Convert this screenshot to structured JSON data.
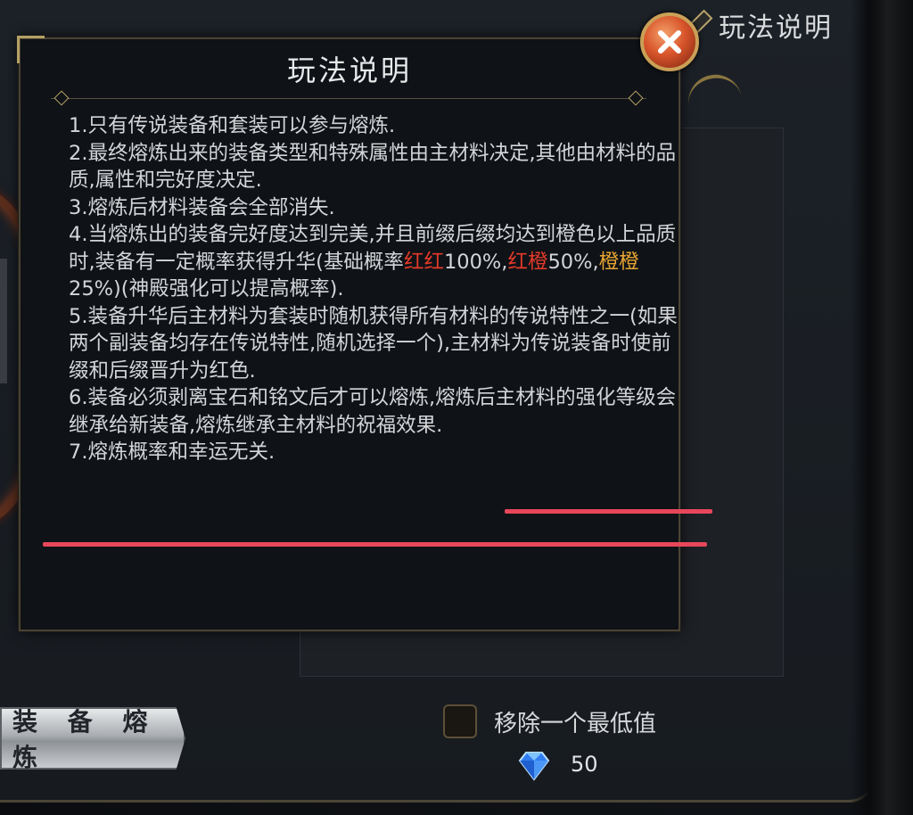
{
  "background": {
    "title": "玩法说明",
    "fusion_button_label": "装 备 熔 炼",
    "remove_lowest_label": "移除一个最低值",
    "gem_count": "50"
  },
  "modal": {
    "title": "玩法说明",
    "rules": [
      {
        "text": "1.只有传说装备和套装可以参与熔炼."
      },
      {
        "text": "2.最终熔炼出来的装备类型和特殊属性由主材料决定,其他由材料的品质,属性和完好度决定."
      },
      {
        "text": "3.熔炼后材料装备会全部消失."
      },
      {
        "prefix": "4.当熔炼出的装备完好度达到完美,并且前缀后缀均达到橙色以上品质时,装备有一定概率获得升华(基础概率",
        "red_red": "红红",
        "red_red_pct": "100%,",
        "red_orange": "红橙",
        "red_orange_pct": "50%,",
        "orange_orange": "橙橙",
        "suffix": "25%)(神殿强化可以提高概率)."
      },
      {
        "text": "5.装备升华后主材料为套装时随机获得所有材料的传说特性之一(如果两个副装备均存在传说特性,随机选择一个),主材料为传说装备时使前缀和后缀晋升为红色."
      },
      {
        "text": "6.装备必须剥离宝石和铭文后才可以熔炼,熔炼后主材料的强化等级会继承给新装备,熔炼继承主材料的祝福效果."
      },
      {
        "text": "7.熔炼概率和幸运无关."
      }
    ]
  },
  "colors": {
    "highlight_red": "#e33a2a",
    "highlight_orange": "#e6a533",
    "annotation_underline": "#e8475b"
  },
  "icons": {
    "close": "close-icon",
    "gem": "diamond-gem-icon"
  }
}
